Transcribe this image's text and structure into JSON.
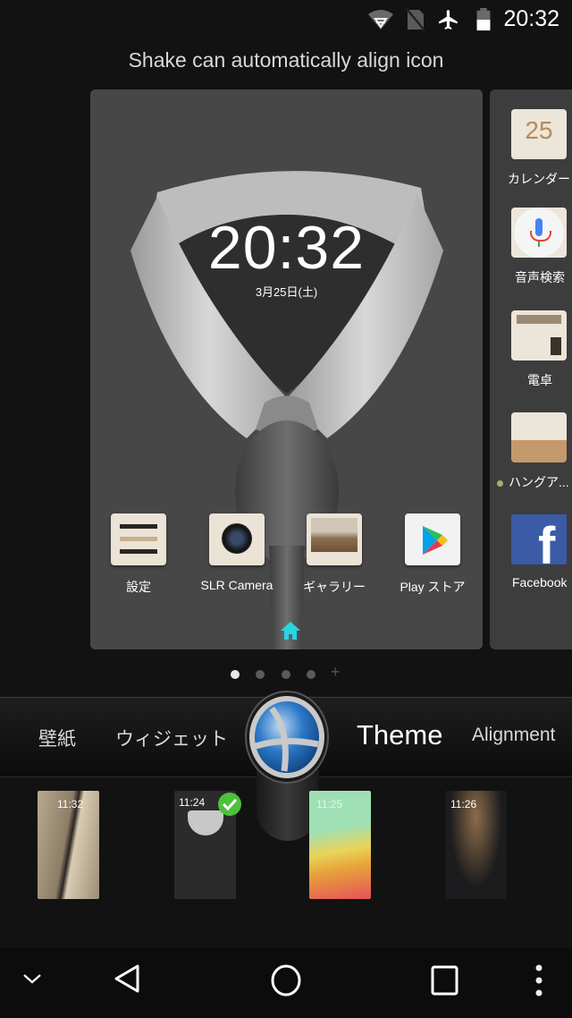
{
  "status_bar": {
    "time": "20:32",
    "icons": [
      "wifi-icon",
      "no-sim-icon",
      "airplane-icon",
      "battery-icon"
    ]
  },
  "hint_text": "Shake can automatically align icon",
  "home_screen": {
    "clock": {
      "time": "20:32",
      "date": "3月25日(土)"
    },
    "dock_apps": [
      {
        "label": "設定",
        "icon": "settings-icon"
      },
      {
        "label": "SLR Camera",
        "icon": "camera-icon"
      },
      {
        "label": "ギャラリー",
        "icon": "gallery-icon"
      },
      {
        "label": "Play ストア",
        "icon": "play-store-icon"
      }
    ],
    "home_indicator_color": "#29d4e0"
  },
  "next_page_apps": [
    {
      "label": "カレンダー",
      "icon": "calendar-icon",
      "badge": "25"
    },
    {
      "label": "音声検索",
      "icon": "voice-search-icon"
    },
    {
      "label": "電卓",
      "icon": "calculator-icon"
    },
    {
      "label": "ハングア...",
      "icon": "hangouts-icon",
      "new_indicator": true
    },
    {
      "label": "Facebook",
      "icon": "facebook-icon"
    }
  ],
  "pager": {
    "pages": 4,
    "current": 1,
    "add_label": "+"
  },
  "edit_tabs": [
    {
      "label": "壁紙",
      "active": false
    },
    {
      "label": "ウィジェット",
      "active": false
    },
    {
      "label": "Theme",
      "active": true
    },
    {
      "label": "Alignment",
      "active": false
    }
  ],
  "themes": [
    {
      "name": "theme-gold-curve",
      "preview_time": "11:32",
      "selected": false
    },
    {
      "name": "theme-shirt-collar",
      "preview_time": "11:24",
      "selected": true
    },
    {
      "name": "theme-colorful",
      "preview_time": "11:25",
      "selected": false
    },
    {
      "name": "theme-dark",
      "preview_time": "11:26",
      "selected": false
    }
  ],
  "colors": {
    "selected_check": "#4cc23a",
    "knob_blue": "#1f66b8"
  },
  "nav_bar": [
    "collapse-icon",
    "back-icon",
    "home-icon",
    "recents-icon",
    "more-icon"
  ]
}
